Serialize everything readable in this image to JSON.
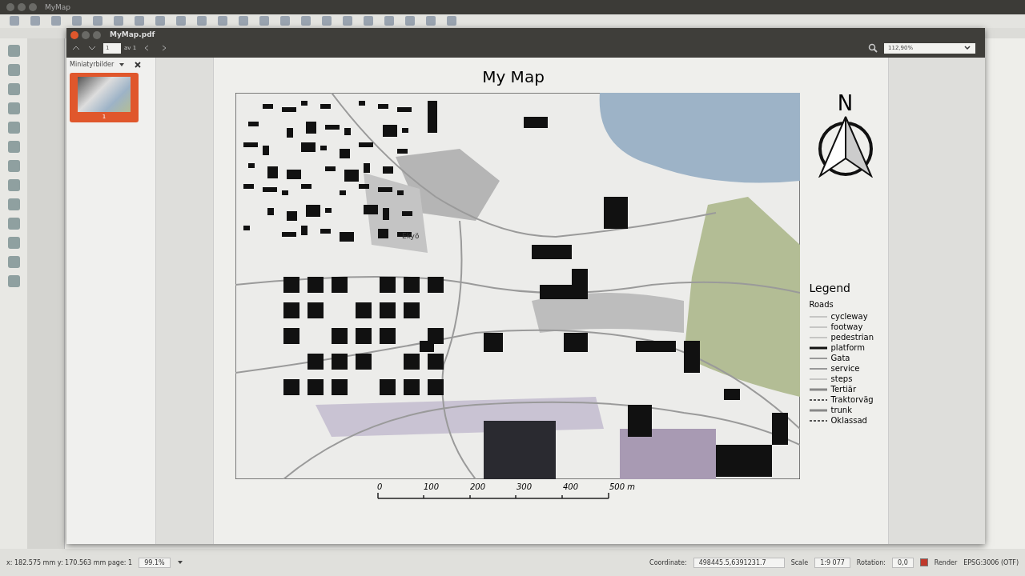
{
  "app": {
    "title": "MyMap"
  },
  "viewer": {
    "title": "MyMap.pdf",
    "page_field": {
      "value": "1",
      "total": "av 1"
    },
    "zoom": "112,90%",
    "sidebar": {
      "title": "Miniatyrbilder",
      "thumbnails": [
        {
          "label": "1",
          "selected": true
        }
      ]
    },
    "page": {
      "title": "My Map",
      "map_label": "Ekyö",
      "north": "N",
      "legend": {
        "title": "Legend",
        "group": "Roads",
        "items": [
          {
            "label": "cycleway",
            "kind": "thin"
          },
          {
            "label": "footway",
            "kind": "thin"
          },
          {
            "label": "pedestrian",
            "kind": "thin"
          },
          {
            "label": "platform",
            "kind": "bold"
          },
          {
            "label": "Gata",
            "kind": "medium"
          },
          {
            "label": "service",
            "kind": "medium"
          },
          {
            "label": "steps",
            "kind": "thin"
          },
          {
            "label": "Tertiär",
            "kind": "wide"
          },
          {
            "label": "Traktorväg",
            "kind": "dashed"
          },
          {
            "label": "trunk",
            "kind": "wide"
          },
          {
            "label": "Oklassad",
            "kind": "dashed"
          }
        ]
      },
      "scale": [
        "0",
        "100",
        "200",
        "300",
        "400",
        "500 m"
      ]
    }
  },
  "status_bar": {
    "coords": "x: 182.575 mm  y: 170.563 mm  page: 1",
    "zoom": "99.1%",
    "coordinate_label": "Coordinate:",
    "coordinate": "498445.5,6391231.7",
    "scale_label": "Scale",
    "scale": "1:9 077",
    "rotation_label": "Rotation:",
    "rotation": "0,0",
    "render": {
      "label": "Render",
      "checked": true
    },
    "crs": "EPSG:3006 (OTF)"
  }
}
